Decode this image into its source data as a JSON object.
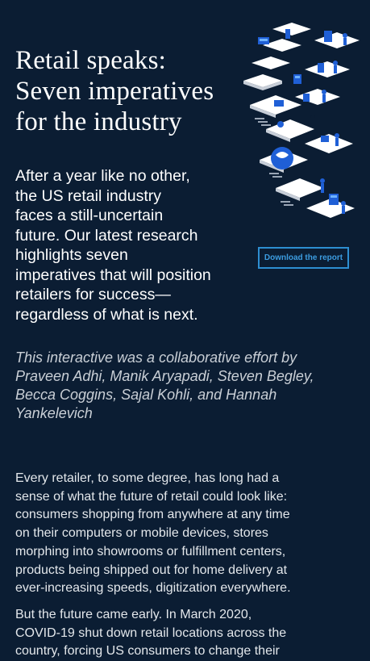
{
  "hero": {
    "title": "Retail speaks:\nSeven imperatives\nfor the industry",
    "intro": "After a year like no other,\nthe US retail industry\nfaces a still-uncertain\nfuture. Our latest research\nhighlights seven\nimperatives that will position\nretailers for success—\nregardless of what is next.",
    "download_label": "Download the report",
    "credit": "This interactive was a collaborative effort by Praveen Adhi, Manik Aryapadi, Steven Begley, Becca Coggins, Sajal Kohli, and Hannah Yankelevich"
  },
  "article": {
    "paragraphs": [
      "Every retailer, to some degree, has long had a\nsense of what the future of retail could look like:\nconsumers shopping from anywhere at any time\non their computers or mobile devices, stores\nmorphing into showrooms or fulfillment centers,\nproducts being shipped out for home delivery at\never-increasing speeds, digitization everywhere.",
      "But the future came early. In March 2020,\nCOVID-19 shut down retail locations across the\ncountry, forcing US consumers to change their"
    ]
  },
  "colors": {
    "background": "#0b1d33",
    "accent": "#2d8ed1",
    "illustration_blue": "#1f5fd6"
  },
  "icons": [
    "isometric-retail-illustration"
  ]
}
